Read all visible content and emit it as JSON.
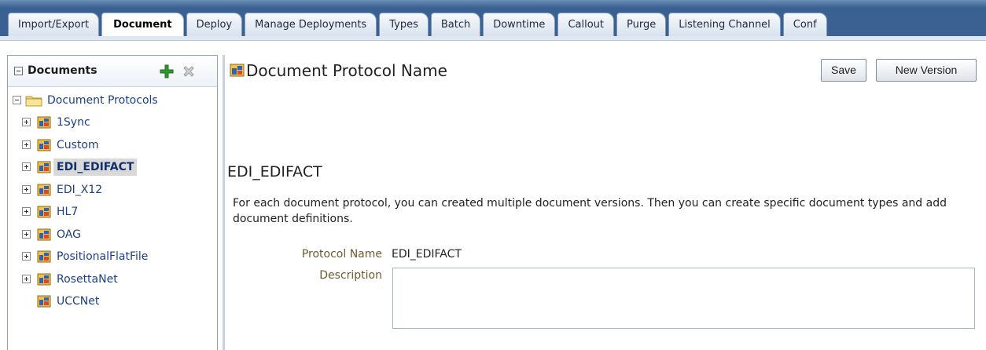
{
  "tabs": [
    {
      "label": "Import/Export",
      "active": false
    },
    {
      "label": "Document",
      "active": true
    },
    {
      "label": "Deploy",
      "active": false
    },
    {
      "label": "Manage Deployments",
      "active": false
    },
    {
      "label": "Types",
      "active": false
    },
    {
      "label": "Batch",
      "active": false
    },
    {
      "label": "Downtime",
      "active": false
    },
    {
      "label": "Callout",
      "active": false
    },
    {
      "label": "Purge",
      "active": false
    },
    {
      "label": "Listening Channel",
      "active": false
    },
    {
      "label": "Conf",
      "active": false
    }
  ],
  "navigator": {
    "title": "Documents",
    "add_icon": "add-icon",
    "remove_icon": "remove-icon",
    "root": {
      "label": "Document Protocols",
      "icon": "folder-icon",
      "expanded": true
    },
    "items": [
      {
        "label": "1Sync",
        "expandable": true,
        "selected": false
      },
      {
        "label": "Custom",
        "expandable": true,
        "selected": false
      },
      {
        "label": "EDI_EDIFACT",
        "expandable": true,
        "selected": true
      },
      {
        "label": "EDI_X12",
        "expandable": true,
        "selected": false
      },
      {
        "label": "HL7",
        "expandable": true,
        "selected": false
      },
      {
        "label": "OAG",
        "expandable": true,
        "selected": false
      },
      {
        "label": "PositionalFlatFile",
        "expandable": true,
        "selected": false
      },
      {
        "label": "RosettaNet",
        "expandable": true,
        "selected": false
      },
      {
        "label": "UCCNet",
        "expandable": false,
        "selected": false
      }
    ]
  },
  "panel": {
    "title": "Document Protocol Name",
    "buttons": {
      "save": "Save",
      "new_version": "New Version"
    },
    "section_title": "EDI_EDIFACT",
    "description": "For each document protocol, you can created multiple document versions. Then you can create specific document types and add document definitions.",
    "fields": {
      "protocol_name_label": "Protocol Name",
      "protocol_name_value": "EDI_EDIFACT",
      "description_label": "Description",
      "description_value": ""
    }
  },
  "colors": {
    "tab_band": "#3a6191",
    "tree_link": "#1c3f8a",
    "field_label": "#6d5a2c",
    "add_green": "#2e9a2e"
  }
}
